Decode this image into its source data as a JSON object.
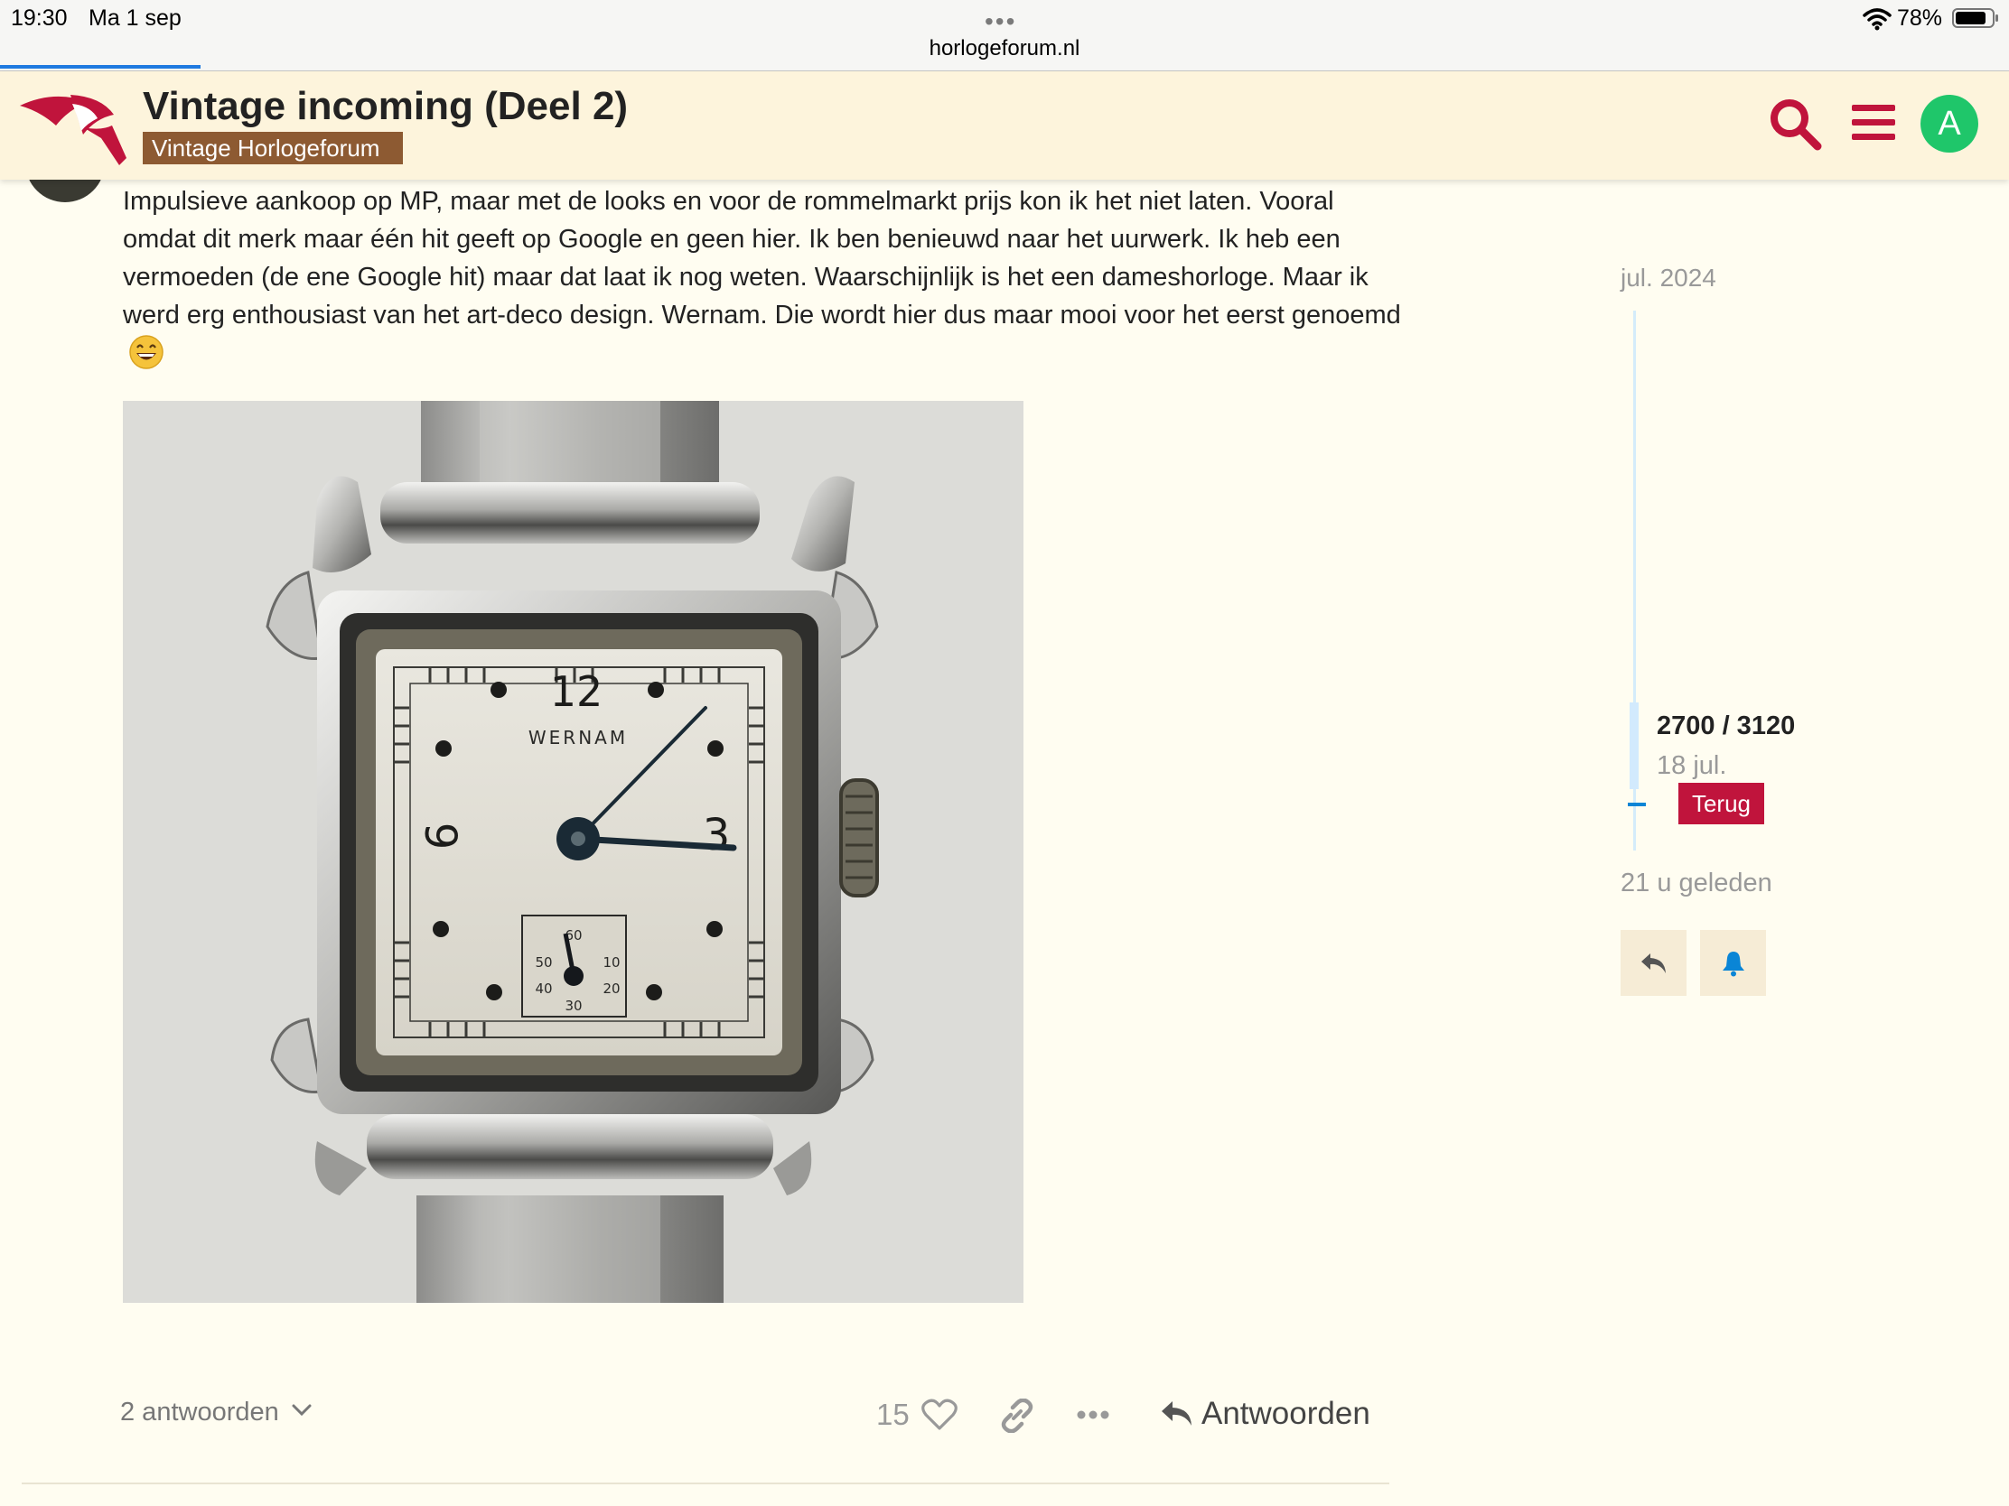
{
  "status_bar": {
    "time": "19:30",
    "date": "Ma 1 sep",
    "battery": "78%",
    "url": "horlogeforum.nl",
    "tabs_dots": "•••"
  },
  "header": {
    "title": "Vintage incoming (Deel 2)",
    "category": "Vintage Horlogeforum",
    "avatar_letter": "A",
    "icons": [
      "logo-icon",
      "search-icon",
      "hamburger-menu-icon"
    ],
    "colors": {
      "brand": "#c0143c",
      "avatar": "#1fc66a",
      "category": "#8d5a32",
      "header_bg": "#fdf4dc"
    }
  },
  "post": {
    "text": "Impulsieve aankoop op MP, maar met de looks en voor de rommelmarkt prijs kon ik het niet laten. Vooral omdat dit merk maar één hit geeft op Google en geen hier. Ik ben benieuwd naar het uurwerk. Ik heb een vermoeden (de ene Google hit) maar dat laat ik nog weten. Waarschijnlijk is het een dameshorloge. Maar ik werd erg enthousiast van het art-deco design. Wernam. Die wordt hier dus maar mooi voor het eerst genoemd",
    "emoji": "grinning-face",
    "image": {
      "dial_brand": "WERNAM",
      "hour_12": "12",
      "hour_3": "3",
      "hour_9": "9",
      "subdial_60": "60",
      "subdial_10": "10",
      "subdial_20": "20",
      "subdial_30": "30",
      "subdial_40": "40",
      "subdial_50": "50"
    },
    "replies_label": "2 antwoorden",
    "like_count": "15",
    "reply_label": "Antwoorden"
  },
  "timeline": {
    "start_label": "jul. 2024",
    "position": "2700 / 3120",
    "position_date": "18 jul.",
    "back_label": "Terug",
    "end_label": "21 u geleden",
    "buttons": [
      "reply-icon",
      "bell-icon"
    ],
    "accent": "#0a85d6"
  }
}
